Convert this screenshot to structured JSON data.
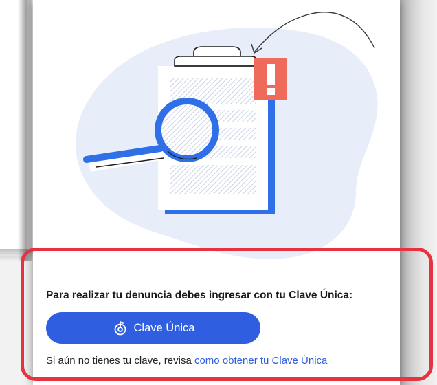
{
  "colors": {
    "accent": "#2f5fe0",
    "alert": "#ef6a5a",
    "highlight_border": "#e8323f",
    "blob": "#e8eef9"
  },
  "illustration": {
    "icons": [
      "clipboard-icon",
      "magnifier-icon",
      "exclamation-icon",
      "curved-arrow-icon"
    ]
  },
  "login": {
    "prompt": "Para realizar tu denuncia debes ingresar con tu Clave Única:",
    "button_icon": "clave-unica-icon",
    "button_label": "Clave Única",
    "help_text": "Si aún no tienes tu clave, revisa ",
    "help_link": "como obtener tu Clave Única"
  }
}
